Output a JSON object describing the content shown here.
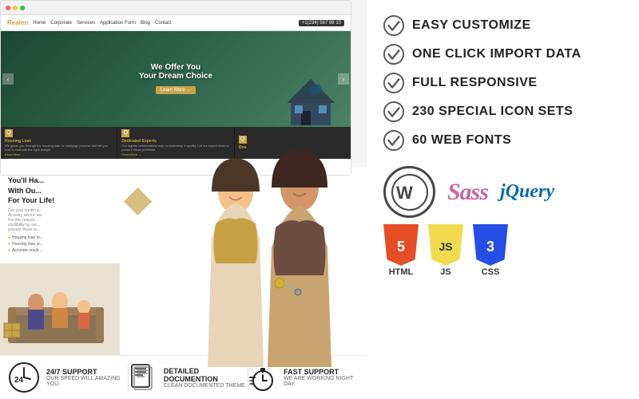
{
  "left": {
    "browser": {
      "logo": "Realen",
      "nav_links": [
        "Home",
        "Corporate",
        "Services",
        "Application Form",
        "Blog",
        "Contact"
      ],
      "phone": "+1(234) 567 89 10"
    },
    "hero": {
      "title": "We Offer You",
      "subtitle": "Your Dream Choice",
      "button": "Learn More →",
      "arrow_left": "‹",
      "arrow_right": "›"
    },
    "info_cards": [
      {
        "icon": "Q",
        "title": "Housing Loan",
        "text": "We guide you through the housing loan or mortgage process and tell you how to evaluate the right budget.",
        "btn": "Read More →"
      },
      {
        "icon": "Q",
        "title": "Dedicated Experts",
        "text": "Our agents unfortunately vary considerably in quality. Let our expert team to prevent these problems.",
        "btn": "Read More →"
      },
      {
        "icon": "Q",
        "title": "One",
        "text": "",
        "btn": ""
      }
    ],
    "overlay": {
      "title": "You'll Have\nWith Our...\nFor Your Life!",
      "subtitle": "",
      "body": "Get your credit ra...\nAt every sector...\nFor this reason...\ncredibility by ou...\nprevent these re..."
    },
    "overlay_items": [
      "Housing loan or...",
      "Housing loan or...",
      "Accurate result..."
    ],
    "bottom_features": [
      {
        "icon": "24",
        "title": "24/7 SUPPORT",
        "subtitle": "OUR SPEED WILL AMAZING YOU."
      },
      {
        "icon": "📄",
        "title": "DETAILED DOCUMENTION",
        "subtitle": "CLEAN DOCUMENTED THEME."
      },
      {
        "icon": "⏱",
        "title": "FAST SUPPORT",
        "subtitle": "WE ARE WORKING NIGHT DAY."
      }
    ]
  },
  "right": {
    "features": [
      {
        "label": "EASY CUSTOMIZE"
      },
      {
        "label": "ONE CLICK IMPORT DATA"
      },
      {
        "label": "FULL RESPONSIVE"
      },
      {
        "label": "230 SPECIAL ICON SETS"
      },
      {
        "label": "60 WEB FONTS"
      }
    ],
    "tech": {
      "wordpress_symbol": "W",
      "sass_label": "Sass",
      "jquery_label": "jQuery",
      "html_label": "HTML",
      "js_label": "JS",
      "css_label": "CSS",
      "html_number": "5",
      "js_number": "JS",
      "css_number": "3"
    }
  }
}
